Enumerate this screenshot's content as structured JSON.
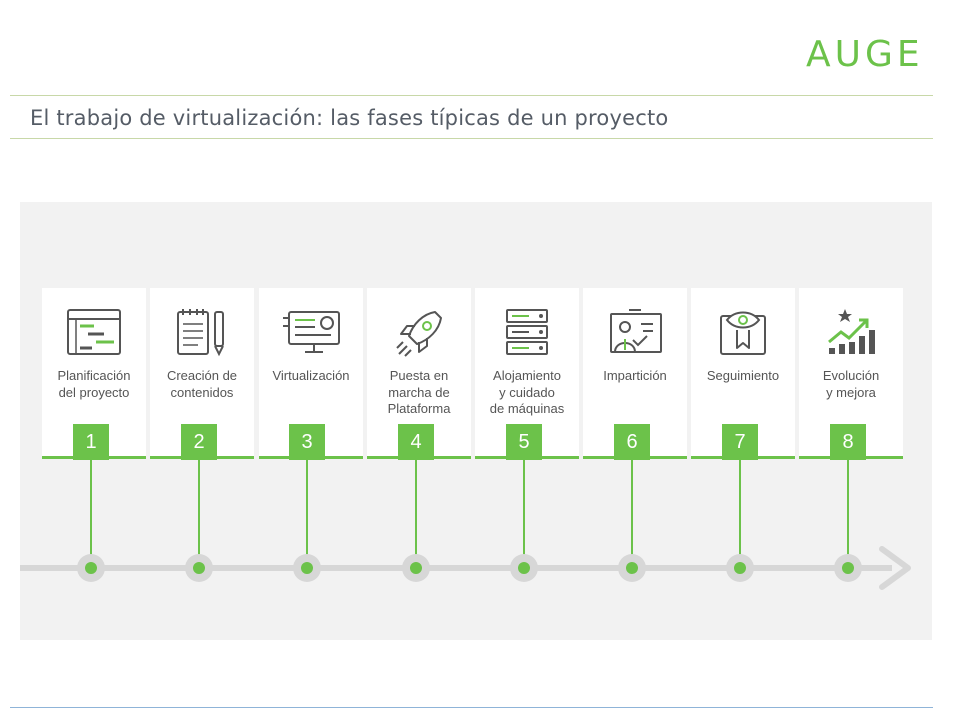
{
  "header": {
    "logo": "AUGE",
    "title": "El trabajo de virtualización: las fases típicas de un proyecto"
  },
  "colors": {
    "accent": "#6cc24a",
    "track": "#d7d7d7",
    "title": "#555c66"
  },
  "phases": [
    {
      "number": "1",
      "label": "Planificación\ndel proyecto",
      "icon": "gantt-chart-icon"
    },
    {
      "number": "2",
      "label": "Creación de\ncontenidos",
      "icon": "notepad-pen-icon"
    },
    {
      "number": "3",
      "label": "Virtualización",
      "icon": "monitor-icon"
    },
    {
      "number": "4",
      "label": "Puesta en\nmarcha de\nPlataforma",
      "icon": "rocket-icon"
    },
    {
      "number": "5",
      "label": "Alojamiento\ny cuidado\nde máquinas",
      "icon": "server-icon"
    },
    {
      "number": "6",
      "label": "Impartición",
      "icon": "teacher-board-icon"
    },
    {
      "number": "7",
      "label": "Seguimiento",
      "icon": "book-eye-icon"
    },
    {
      "number": "8",
      "label": "Evolución\ny mejora",
      "icon": "growth-chart-icon"
    }
  ]
}
